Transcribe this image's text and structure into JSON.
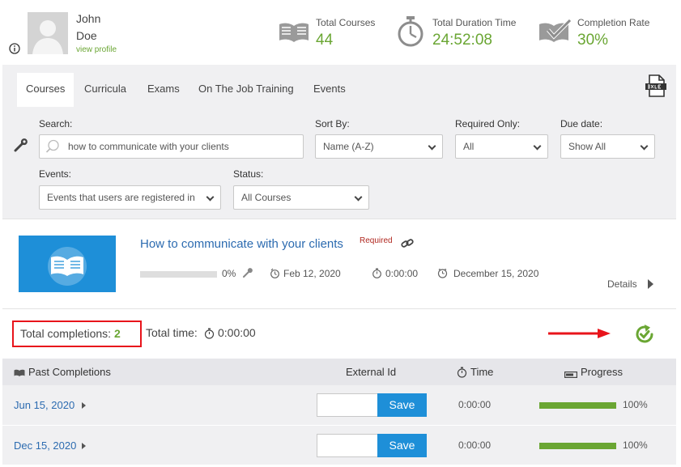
{
  "profile": {
    "first_name": "John",
    "last_name": "Doe",
    "view_profile": "view profile"
  },
  "stats": {
    "total_courses": {
      "label": "Total Courses",
      "value": "44",
      "icon": "open-book-icon"
    },
    "duration": {
      "label": "Total Duration Time",
      "value": "24:52:08",
      "icon": "stopwatch-icon"
    },
    "completion": {
      "label": "Completion Rate",
      "value": "30%",
      "icon": "book-check-icon"
    }
  },
  "tabs": [
    {
      "label": "Courses",
      "active": true
    },
    {
      "label": "Curricula",
      "active": false
    },
    {
      "label": "Exams",
      "active": false
    },
    {
      "label": "On The Job Training",
      "active": false
    },
    {
      "label": "Events",
      "active": false
    }
  ],
  "filters": {
    "search": {
      "label": "Search:",
      "value": "how to communicate with your clients"
    },
    "sort": {
      "label": "Sort By:",
      "value": "Name (A-Z)"
    },
    "required": {
      "label": "Required Only:",
      "value": "All"
    },
    "due": {
      "label": "Due date:",
      "value": "Show All"
    },
    "events": {
      "label": "Events:",
      "value": "Events that users are registered in"
    },
    "status": {
      "label": "Status:",
      "value": "All Courses"
    }
  },
  "course": {
    "title": "How to communicate with your clients",
    "required": "Required",
    "progress_percent": 0,
    "progress_label": "0%",
    "start_date": "Feb 12, 2020",
    "duration": "0:00:00",
    "due_date": "December 15, 2020",
    "details": "Details"
  },
  "totals": {
    "completions_label": "Total completions:",
    "completions_value": "2",
    "time_label": "Total time:",
    "time_value": "0:00:00"
  },
  "table": {
    "headers": {
      "past": "Past Completions",
      "external": "External Id",
      "time": "Time",
      "progress": "Progress"
    },
    "rows": [
      {
        "date": "Jun 15, 2020",
        "external_id": "",
        "save": "Save",
        "time": "0:00:00",
        "progress": 100,
        "progress_label": "100%"
      },
      {
        "date": "Dec 15, 2020",
        "external_id": "",
        "save": "Save",
        "time": "0:00:00",
        "progress": 100,
        "progress_label": "100%"
      }
    ]
  },
  "colors": {
    "accent_green": "#6aa633",
    "link_blue": "#2c6bb0",
    "button_blue": "#1e8fd8",
    "highlight_red": "#e8141b",
    "required_red": "#b0271f"
  }
}
